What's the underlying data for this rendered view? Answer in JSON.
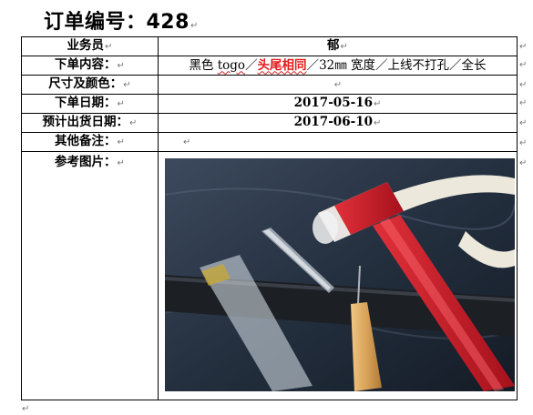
{
  "header": {
    "title": "订单编号：428"
  },
  "marks": {
    "para": "↵"
  },
  "order": {
    "salesperson_label": "业务员",
    "salesperson_value": "郁",
    "content_label": "下单内容：",
    "content": {
      "color": "黑色",
      "material": "togo",
      "sep": "／",
      "head_tail": "头尾相同",
      "width_num": "32",
      "width_unit": "㎜",
      "width_text": "宽度",
      "holes": "上线不打孔",
      "length": "全长"
    },
    "size_color_label": "尺寸及颜色：",
    "size_color_value": "",
    "order_date_label": "下单日期：",
    "order_date": "2017-05-16",
    "ship_date_label": "预计出货日期：",
    "ship_date": "2017-06-10",
    "remarks_label": "其他备注：",
    "remarks_value": "",
    "reference_label": "参考图片："
  }
}
